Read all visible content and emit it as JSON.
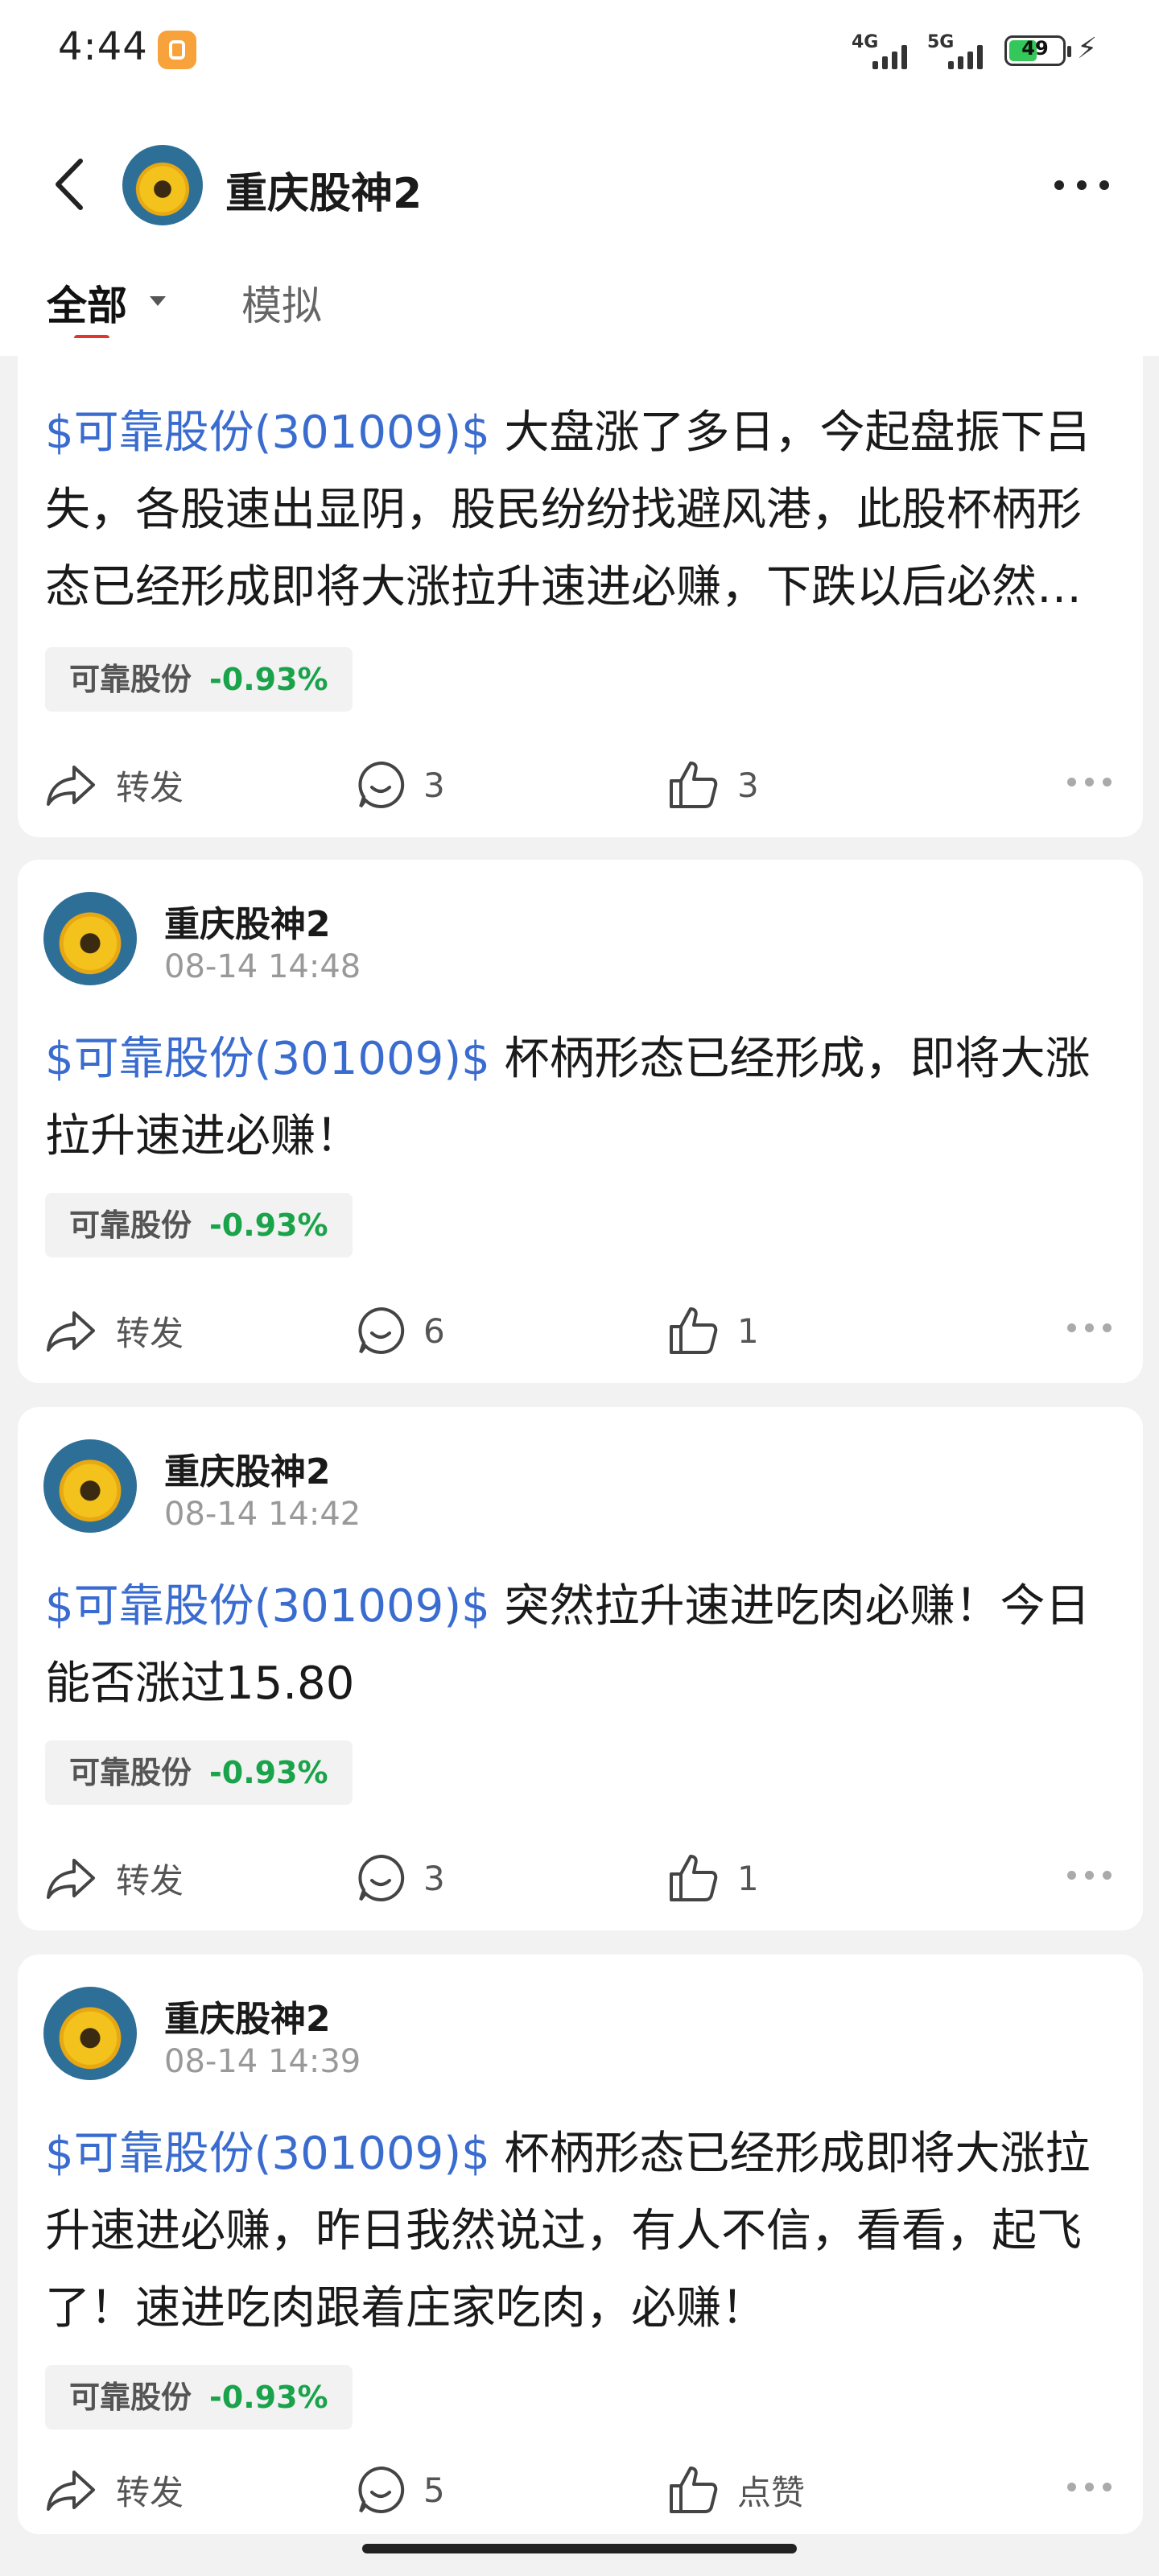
{
  "status_bar": {
    "time": "4:44",
    "signal_1": "4G",
    "signal_2": "5G",
    "battery": "49"
  },
  "header": {
    "title": "重庆股神2"
  },
  "tabs": {
    "all": "全部",
    "simulated": "模拟"
  },
  "posts": [
    {
      "link": "$可靠股份(301009)$",
      "text": " 大盘涨了多日，今起盘振下吕失，各股速出显阴，股民纷纷找避风港，此股杯柄形态已经形成即将大涨拉升速进必赚，下跌以后必然反弹",
      "tag_name": "可靠股份",
      "tag_change": "-0.93%",
      "repost": "转发",
      "comments": "3",
      "likes": "3"
    },
    {
      "author": "重庆股神2",
      "date": "08-14 14:48",
      "link": "$可靠股份(301009)$",
      "text": " 杯柄形态已经形成，即将大涨拉升速进必赚！",
      "tag_name": "可靠股份",
      "tag_change": "-0.93%",
      "repost": "转发",
      "comments": "6",
      "likes": "1"
    },
    {
      "author": "重庆股神2",
      "date": "08-14 14:42",
      "link": "$可靠股份(301009)$",
      "text": " 突然拉升速进吃肉必赚！今日能否涨过15.80",
      "tag_name": "可靠股份",
      "tag_change": "-0.93%",
      "repost": "转发",
      "comments": "3",
      "likes": "1"
    },
    {
      "author": "重庆股神2",
      "date": "08-14 14:39",
      "link": "$可靠股份(301009)$",
      "text": " 杯柄形态已经形成即将大涨拉升速进必赚，昨日我然说过，有人不信，看看，起飞了！速进吃肉跟着庄家吃肉，必赚！",
      "tag_name": "可靠股份",
      "tag_change": "-0.93%",
      "repost": "转发",
      "comments": "5",
      "likes": "点赞"
    }
  ],
  "colors": {
    "link": "#3a6cd0",
    "negative_change": "#1aa34a",
    "accent": "#e3352d"
  }
}
